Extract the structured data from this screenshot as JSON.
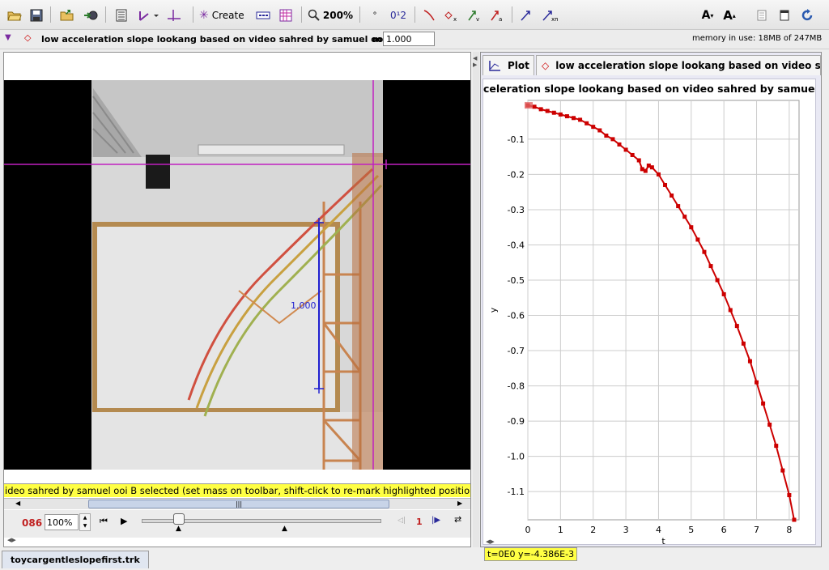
{
  "toolbar": {
    "create_label": "Create",
    "zoom_label": "200%",
    "coord_label": "0¹2"
  },
  "propbar": {
    "track_title": "low acceleration slope lookang based on video sahred by samuel ooi B",
    "mass_label": "m",
    "mass_value": "1.000",
    "memory": "memory in use: 18MB of 247MB"
  },
  "video": {
    "calibration_label": "1.000",
    "status_text": "ideo sahred by samuel ooi B selected (set mass on toolbar, shift-click to re-mark highlighted position)",
    "scroll_glyph": "|||"
  },
  "player": {
    "frame_number": "086",
    "zoom_value": "100%",
    "step_value": "1"
  },
  "file_tab": "toycargentleslopefirst.trk",
  "plot_panel": {
    "tab_plot": "Plot",
    "tab_track": "low acceleration slope lookang based on video sahred by",
    "title": "celeration slope lookang based on video sahred by samuel",
    "readout": "t=0E0  y=-4.386E-3",
    "colors": {
      "track": "#cc0000",
      "grid": "#cccccc",
      "axis": "#000000"
    }
  },
  "chart_data": {
    "type": "scatter",
    "title": "celeration slope lookang based on video sahred by samuel",
    "xlabel": "t",
    "ylabel": "y",
    "xlim": [
      0,
      8.3
    ],
    "ylim": [
      -1.18,
      0.01
    ],
    "x_ticks": [
      0,
      1,
      2,
      3,
      4,
      5,
      6,
      7,
      8
    ],
    "y_ticks": [
      -0.1,
      -0.2,
      -0.3,
      -0.4,
      -0.5,
      -0.6,
      -0.7,
      -0.8,
      -0.9,
      -1.0,
      -1.1
    ],
    "y_tick_labels": [
      "-0.1",
      "-0.2",
      "-0.3",
      "-0.4",
      "-0.5",
      "-0.6",
      "-0.7",
      "-0.8",
      "-0.9",
      "-1.0",
      "-1.1"
    ],
    "grid": true,
    "series": [
      {
        "color": "#cc0000",
        "x": [
          0,
          0.2,
          0.4,
          0.6,
          0.8,
          1.0,
          1.2,
          1.4,
          1.6,
          1.8,
          2.0,
          2.2,
          2.4,
          2.6,
          2.8,
          3.0,
          3.2,
          3.4,
          3.5,
          3.6,
          3.7,
          3.8,
          4.0,
          4.2,
          4.4,
          4.6,
          4.8,
          5.0,
          5.2,
          5.4,
          5.6,
          5.8,
          6.0,
          6.2,
          6.4,
          6.6,
          6.8,
          7.0,
          7.2,
          7.4,
          7.6,
          7.8,
          8.0,
          8.15
        ],
        "y": [
          -0.004,
          -0.008,
          -0.015,
          -0.02,
          -0.025,
          -0.03,
          -0.035,
          -0.04,
          -0.045,
          -0.055,
          -0.065,
          -0.075,
          -0.09,
          -0.1,
          -0.115,
          -0.13,
          -0.145,
          -0.16,
          -0.185,
          -0.19,
          -0.175,
          -0.18,
          -0.2,
          -0.23,
          -0.26,
          -0.29,
          -0.32,
          -0.35,
          -0.385,
          -0.42,
          -0.46,
          -0.5,
          -0.54,
          -0.585,
          -0.63,
          -0.68,
          -0.73,
          -0.79,
          -0.85,
          -0.91,
          -0.97,
          -1.04,
          -1.11,
          -1.18
        ]
      }
    ]
  }
}
